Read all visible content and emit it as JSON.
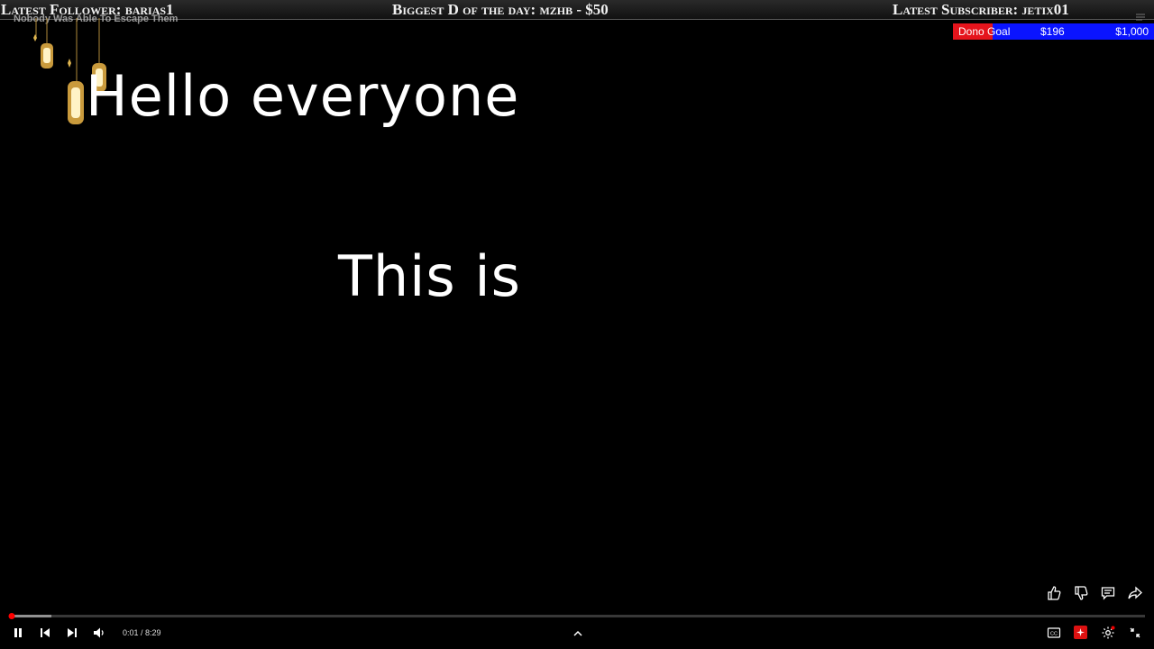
{
  "ticker": {
    "latest_follower": "Latest Follower: barias1",
    "biggest_dono": "Biggest D of the day: mzhb - $50",
    "latest_subscriber": "Latest Subscriber: jetix01"
  },
  "overlay_title": "Nobody Was Able To Escape Them",
  "dono_goal": {
    "label": "Dono Goal",
    "current": "$196",
    "target": "$1,000",
    "progress": 0.196,
    "fill_color": "#e5141c",
    "bar_color": "#0a14ff"
  },
  "captions": {
    "line1": "Hello everyone",
    "line2": "This is"
  },
  "player": {
    "current_time": "0:01",
    "duration": "8:29",
    "time_display": "0:01 / 8:29",
    "played_fraction": 0.002,
    "buffered_fraction": 0.037,
    "accent": "#ff0000"
  },
  "icons": {
    "actions": [
      "like-icon",
      "dislike-icon",
      "comments-icon",
      "share-icon"
    ],
    "left_controls": [
      "pause-icon",
      "previous-icon",
      "next-icon",
      "volume-icon"
    ],
    "right_controls": [
      "captions-icon",
      "miniplayer-icon",
      "settings-icon",
      "exit-fullscreen-icon"
    ]
  }
}
